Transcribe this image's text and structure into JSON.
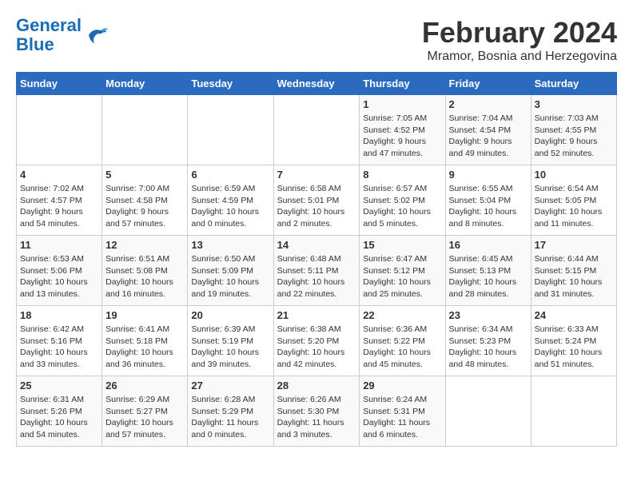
{
  "header": {
    "logo_line1": "General",
    "logo_line2": "Blue",
    "month": "February 2024",
    "location": "Mramor, Bosnia and Herzegovina"
  },
  "days_of_week": [
    "Sunday",
    "Monday",
    "Tuesday",
    "Wednesday",
    "Thursday",
    "Friday",
    "Saturday"
  ],
  "weeks": [
    [
      {
        "day": "",
        "info": ""
      },
      {
        "day": "",
        "info": ""
      },
      {
        "day": "",
        "info": ""
      },
      {
        "day": "",
        "info": ""
      },
      {
        "day": "1",
        "info": "Sunrise: 7:05 AM\nSunset: 4:52 PM\nDaylight: 9 hours\nand 47 minutes."
      },
      {
        "day": "2",
        "info": "Sunrise: 7:04 AM\nSunset: 4:54 PM\nDaylight: 9 hours\nand 49 minutes."
      },
      {
        "day": "3",
        "info": "Sunrise: 7:03 AM\nSunset: 4:55 PM\nDaylight: 9 hours\nand 52 minutes."
      }
    ],
    [
      {
        "day": "4",
        "info": "Sunrise: 7:02 AM\nSunset: 4:57 PM\nDaylight: 9 hours\nand 54 minutes."
      },
      {
        "day": "5",
        "info": "Sunrise: 7:00 AM\nSunset: 4:58 PM\nDaylight: 9 hours\nand 57 minutes."
      },
      {
        "day": "6",
        "info": "Sunrise: 6:59 AM\nSunset: 4:59 PM\nDaylight: 10 hours\nand 0 minutes."
      },
      {
        "day": "7",
        "info": "Sunrise: 6:58 AM\nSunset: 5:01 PM\nDaylight: 10 hours\nand 2 minutes."
      },
      {
        "day": "8",
        "info": "Sunrise: 6:57 AM\nSunset: 5:02 PM\nDaylight: 10 hours\nand 5 minutes."
      },
      {
        "day": "9",
        "info": "Sunrise: 6:55 AM\nSunset: 5:04 PM\nDaylight: 10 hours\nand 8 minutes."
      },
      {
        "day": "10",
        "info": "Sunrise: 6:54 AM\nSunset: 5:05 PM\nDaylight: 10 hours\nand 11 minutes."
      }
    ],
    [
      {
        "day": "11",
        "info": "Sunrise: 6:53 AM\nSunset: 5:06 PM\nDaylight: 10 hours\nand 13 minutes."
      },
      {
        "day": "12",
        "info": "Sunrise: 6:51 AM\nSunset: 5:08 PM\nDaylight: 10 hours\nand 16 minutes."
      },
      {
        "day": "13",
        "info": "Sunrise: 6:50 AM\nSunset: 5:09 PM\nDaylight: 10 hours\nand 19 minutes."
      },
      {
        "day": "14",
        "info": "Sunrise: 6:48 AM\nSunset: 5:11 PM\nDaylight: 10 hours\nand 22 minutes."
      },
      {
        "day": "15",
        "info": "Sunrise: 6:47 AM\nSunset: 5:12 PM\nDaylight: 10 hours\nand 25 minutes."
      },
      {
        "day": "16",
        "info": "Sunrise: 6:45 AM\nSunset: 5:13 PM\nDaylight: 10 hours\nand 28 minutes."
      },
      {
        "day": "17",
        "info": "Sunrise: 6:44 AM\nSunset: 5:15 PM\nDaylight: 10 hours\nand 31 minutes."
      }
    ],
    [
      {
        "day": "18",
        "info": "Sunrise: 6:42 AM\nSunset: 5:16 PM\nDaylight: 10 hours\nand 33 minutes."
      },
      {
        "day": "19",
        "info": "Sunrise: 6:41 AM\nSunset: 5:18 PM\nDaylight: 10 hours\nand 36 minutes."
      },
      {
        "day": "20",
        "info": "Sunrise: 6:39 AM\nSunset: 5:19 PM\nDaylight: 10 hours\nand 39 minutes."
      },
      {
        "day": "21",
        "info": "Sunrise: 6:38 AM\nSunset: 5:20 PM\nDaylight: 10 hours\nand 42 minutes."
      },
      {
        "day": "22",
        "info": "Sunrise: 6:36 AM\nSunset: 5:22 PM\nDaylight: 10 hours\nand 45 minutes."
      },
      {
        "day": "23",
        "info": "Sunrise: 6:34 AM\nSunset: 5:23 PM\nDaylight: 10 hours\nand 48 minutes."
      },
      {
        "day": "24",
        "info": "Sunrise: 6:33 AM\nSunset: 5:24 PM\nDaylight: 10 hours\nand 51 minutes."
      }
    ],
    [
      {
        "day": "25",
        "info": "Sunrise: 6:31 AM\nSunset: 5:26 PM\nDaylight: 10 hours\nand 54 minutes."
      },
      {
        "day": "26",
        "info": "Sunrise: 6:29 AM\nSunset: 5:27 PM\nDaylight: 10 hours\nand 57 minutes."
      },
      {
        "day": "27",
        "info": "Sunrise: 6:28 AM\nSunset: 5:29 PM\nDaylight: 11 hours\nand 0 minutes."
      },
      {
        "day": "28",
        "info": "Sunrise: 6:26 AM\nSunset: 5:30 PM\nDaylight: 11 hours\nand 3 minutes."
      },
      {
        "day": "29",
        "info": "Sunrise: 6:24 AM\nSunset: 5:31 PM\nDaylight: 11 hours\nand 6 minutes."
      },
      {
        "day": "",
        "info": ""
      },
      {
        "day": "",
        "info": ""
      }
    ]
  ]
}
